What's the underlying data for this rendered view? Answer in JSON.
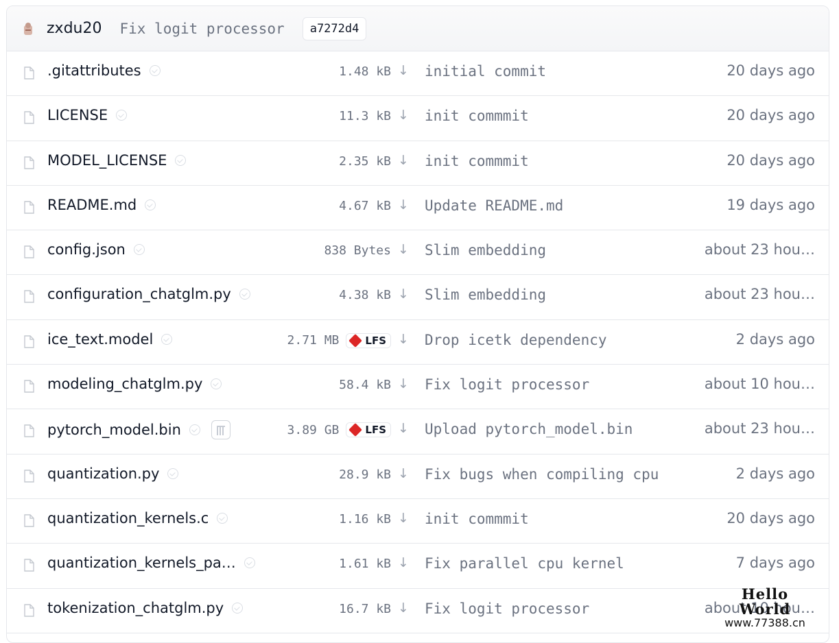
{
  "header": {
    "author": "zxdu20",
    "commit_message": "Fix logit processor",
    "commit_hash": "a7272d4"
  },
  "files": [
    {
      "name": ".gitattributes",
      "size": "1.48 kB",
      "lfs": false,
      "pickle": false,
      "last_commit": "initial commit",
      "date": "20 days ago"
    },
    {
      "name": "LICENSE",
      "size": "11.3 kB",
      "lfs": false,
      "pickle": false,
      "last_commit": "init commmit",
      "date": "20 days ago"
    },
    {
      "name": "MODEL_LICENSE",
      "size": "2.35 kB",
      "lfs": false,
      "pickle": false,
      "last_commit": "init commmit",
      "date": "20 days ago"
    },
    {
      "name": "README.md",
      "size": "4.67 kB",
      "lfs": false,
      "pickle": false,
      "last_commit": "Update README.md",
      "date": "19 days ago"
    },
    {
      "name": "config.json",
      "size": "838 Bytes",
      "lfs": false,
      "pickle": false,
      "last_commit": "Slim embedding",
      "date": "about 23 hou…"
    },
    {
      "name": "configuration_chatglm.py",
      "size": "4.38 kB",
      "lfs": false,
      "pickle": false,
      "last_commit": "Slim embedding",
      "date": "about 23 hou…"
    },
    {
      "name": "ice_text.model",
      "size": "2.71 MB",
      "lfs": true,
      "pickle": false,
      "last_commit": "Drop icetk dependency",
      "date": "2 days ago"
    },
    {
      "name": "modeling_chatglm.py",
      "size": "58.4 kB",
      "lfs": false,
      "pickle": false,
      "last_commit": "Fix logit processor",
      "date": "about 10 hou…"
    },
    {
      "name": "pytorch_model.bin",
      "size": "3.89 GB",
      "lfs": true,
      "pickle": true,
      "last_commit": "Upload pytorch_model.bin",
      "date": "about 23 hou…"
    },
    {
      "name": "quantization.py",
      "size": "28.9 kB",
      "lfs": false,
      "pickle": false,
      "last_commit": "Fix bugs when compiling cpu",
      "date": "2 days ago"
    },
    {
      "name": "quantization_kernels.c",
      "size": "1.16 kB",
      "lfs": false,
      "pickle": false,
      "last_commit": "init commmit",
      "date": "20 days ago"
    },
    {
      "name": "quantization_kernels_pa…",
      "size": "1.61 kB",
      "lfs": false,
      "pickle": false,
      "last_commit": "Fix parallel cpu kernel",
      "date": "7 days ago"
    },
    {
      "name": "tokenization_chatglm.py",
      "size": "16.7 kB",
      "lfs": false,
      "pickle": false,
      "last_commit": "Fix logit processor",
      "date": "about 10 hou…"
    }
  ],
  "labels": {
    "lfs": "LFS",
    "download_arrow": "↓"
  },
  "icons": {
    "file": "file-icon",
    "safe": "shield-check-icon",
    "pickle": "pickle-scan-icon",
    "lfs": "lfs-icon",
    "download": "download-arrow-icon"
  },
  "colors": {
    "lfs_accent": "#dc2626",
    "text_primary": "#111827",
    "text_muted": "#6b7280",
    "border": "#e5e7eb"
  },
  "watermark": {
    "title": "Hello World",
    "url": "www.77388.cn"
  }
}
